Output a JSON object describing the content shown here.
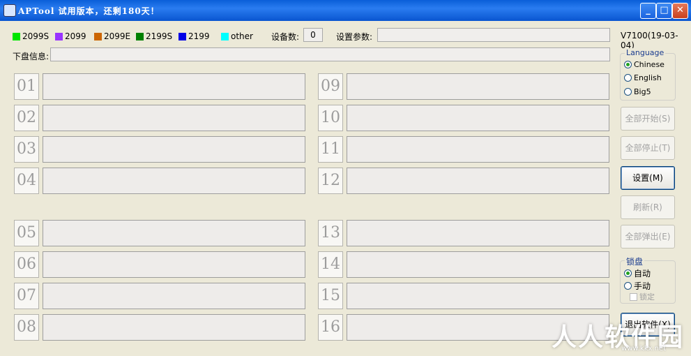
{
  "window": {
    "title": "APTool   试用版本，还剩180天！",
    "minimize": "_",
    "maximize": "□",
    "close": "✕"
  },
  "legend": [
    {
      "label": "2099S",
      "color": "#00e600"
    },
    {
      "label": "2099",
      "color": "#9933ff"
    },
    {
      "label": "2099E",
      "color": "#cc6600"
    },
    {
      "label": "2199S",
      "color": "#008000"
    },
    {
      "label": "2199",
      "color": "#0000e6"
    },
    {
      "label": "other",
      "color": "#00ffff"
    }
  ],
  "device_count_label": "设备数:",
  "device_count_value": "0",
  "settings_param_label": "设置参数:",
  "settings_param_value": "",
  "version": "V7100(19-03-04)",
  "download_info_label": "下盘信息:",
  "download_info_value": "",
  "slots_left": [
    "01",
    "02",
    "03",
    "04",
    "05",
    "06",
    "07",
    "08"
  ],
  "slots_right": [
    "09",
    "10",
    "11",
    "12",
    "13",
    "14",
    "15",
    "16"
  ],
  "language": {
    "title": "Language",
    "options": [
      "Chinese",
      "English",
      "Big5"
    ],
    "selected": "Chinese"
  },
  "buttons": {
    "start_all": "全部开始(S)",
    "stop_all": "全部停止(T)",
    "settings": "设置(M)",
    "refresh": "刷新(R)",
    "eject_all": "全部弹出(E)",
    "exit": "退出软件(X)"
  },
  "lock": {
    "title": "锁盘",
    "options": [
      "自动",
      "手动"
    ],
    "selected": "自动",
    "lock_checkbox": "锁定"
  },
  "watermark": {
    "text": "人人软件园",
    "url": "www.kkx.net"
  }
}
